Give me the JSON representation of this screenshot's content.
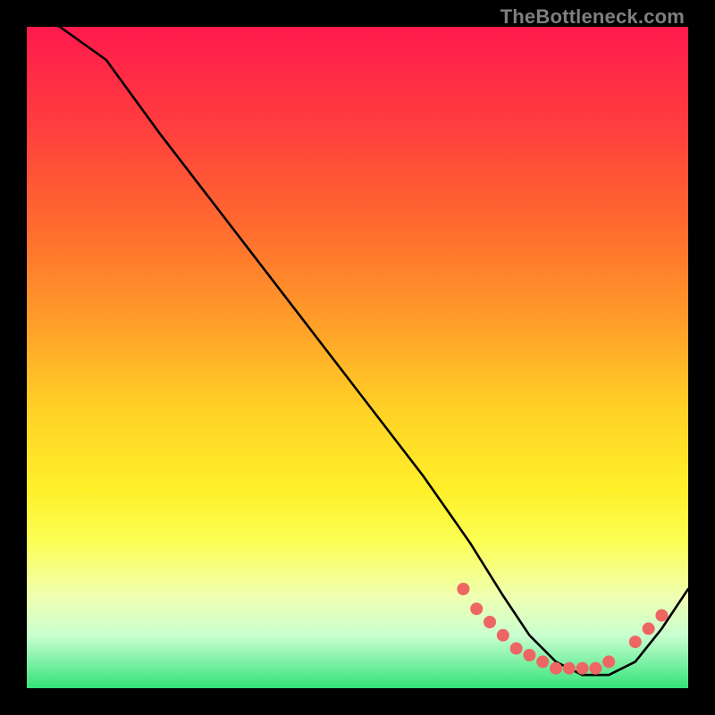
{
  "attribution": "TheBottleneck.com",
  "colors": {
    "background": "#000000",
    "line": "#000000",
    "marker": "#ee6663",
    "attribution_text": "#7f7f7f",
    "gradient_stops": [
      "#ff1a4d",
      "#ff3b3f",
      "#ff6a2f",
      "#ffa328",
      "#ffd226",
      "#fff02a",
      "#fbff55",
      "#f0ffb0",
      "#c9ffd0",
      "#34e27a"
    ]
  },
  "chart_data": {
    "type": "line",
    "title": "",
    "xlabel": "",
    "ylabel": "",
    "xlim": [
      0,
      100
    ],
    "ylim": [
      0,
      100
    ],
    "grid": false,
    "series": [
      {
        "name": "bottleneck-curve",
        "x": [
          0,
          5,
          12,
          20,
          30,
          40,
          50,
          60,
          67,
          72,
          76,
          80,
          84,
          88,
          92,
          96,
          100
        ],
        "y": [
          102,
          100,
          95,
          84,
          71,
          58,
          45,
          32,
          22,
          14,
          8,
          4,
          2,
          2,
          4,
          9,
          15
        ]
      }
    ],
    "markers": [
      {
        "x": 66,
        "y": 15
      },
      {
        "x": 68,
        "y": 12
      },
      {
        "x": 70,
        "y": 10
      },
      {
        "x": 72,
        "y": 8
      },
      {
        "x": 74,
        "y": 6
      },
      {
        "x": 76,
        "y": 5
      },
      {
        "x": 78,
        "y": 4
      },
      {
        "x": 80,
        "y": 3
      },
      {
        "x": 82,
        "y": 3
      },
      {
        "x": 84,
        "y": 3
      },
      {
        "x": 86,
        "y": 3
      },
      {
        "x": 88,
        "y": 4
      },
      {
        "x": 92,
        "y": 7
      },
      {
        "x": 94,
        "y": 9
      },
      {
        "x": 96,
        "y": 11
      }
    ]
  }
}
